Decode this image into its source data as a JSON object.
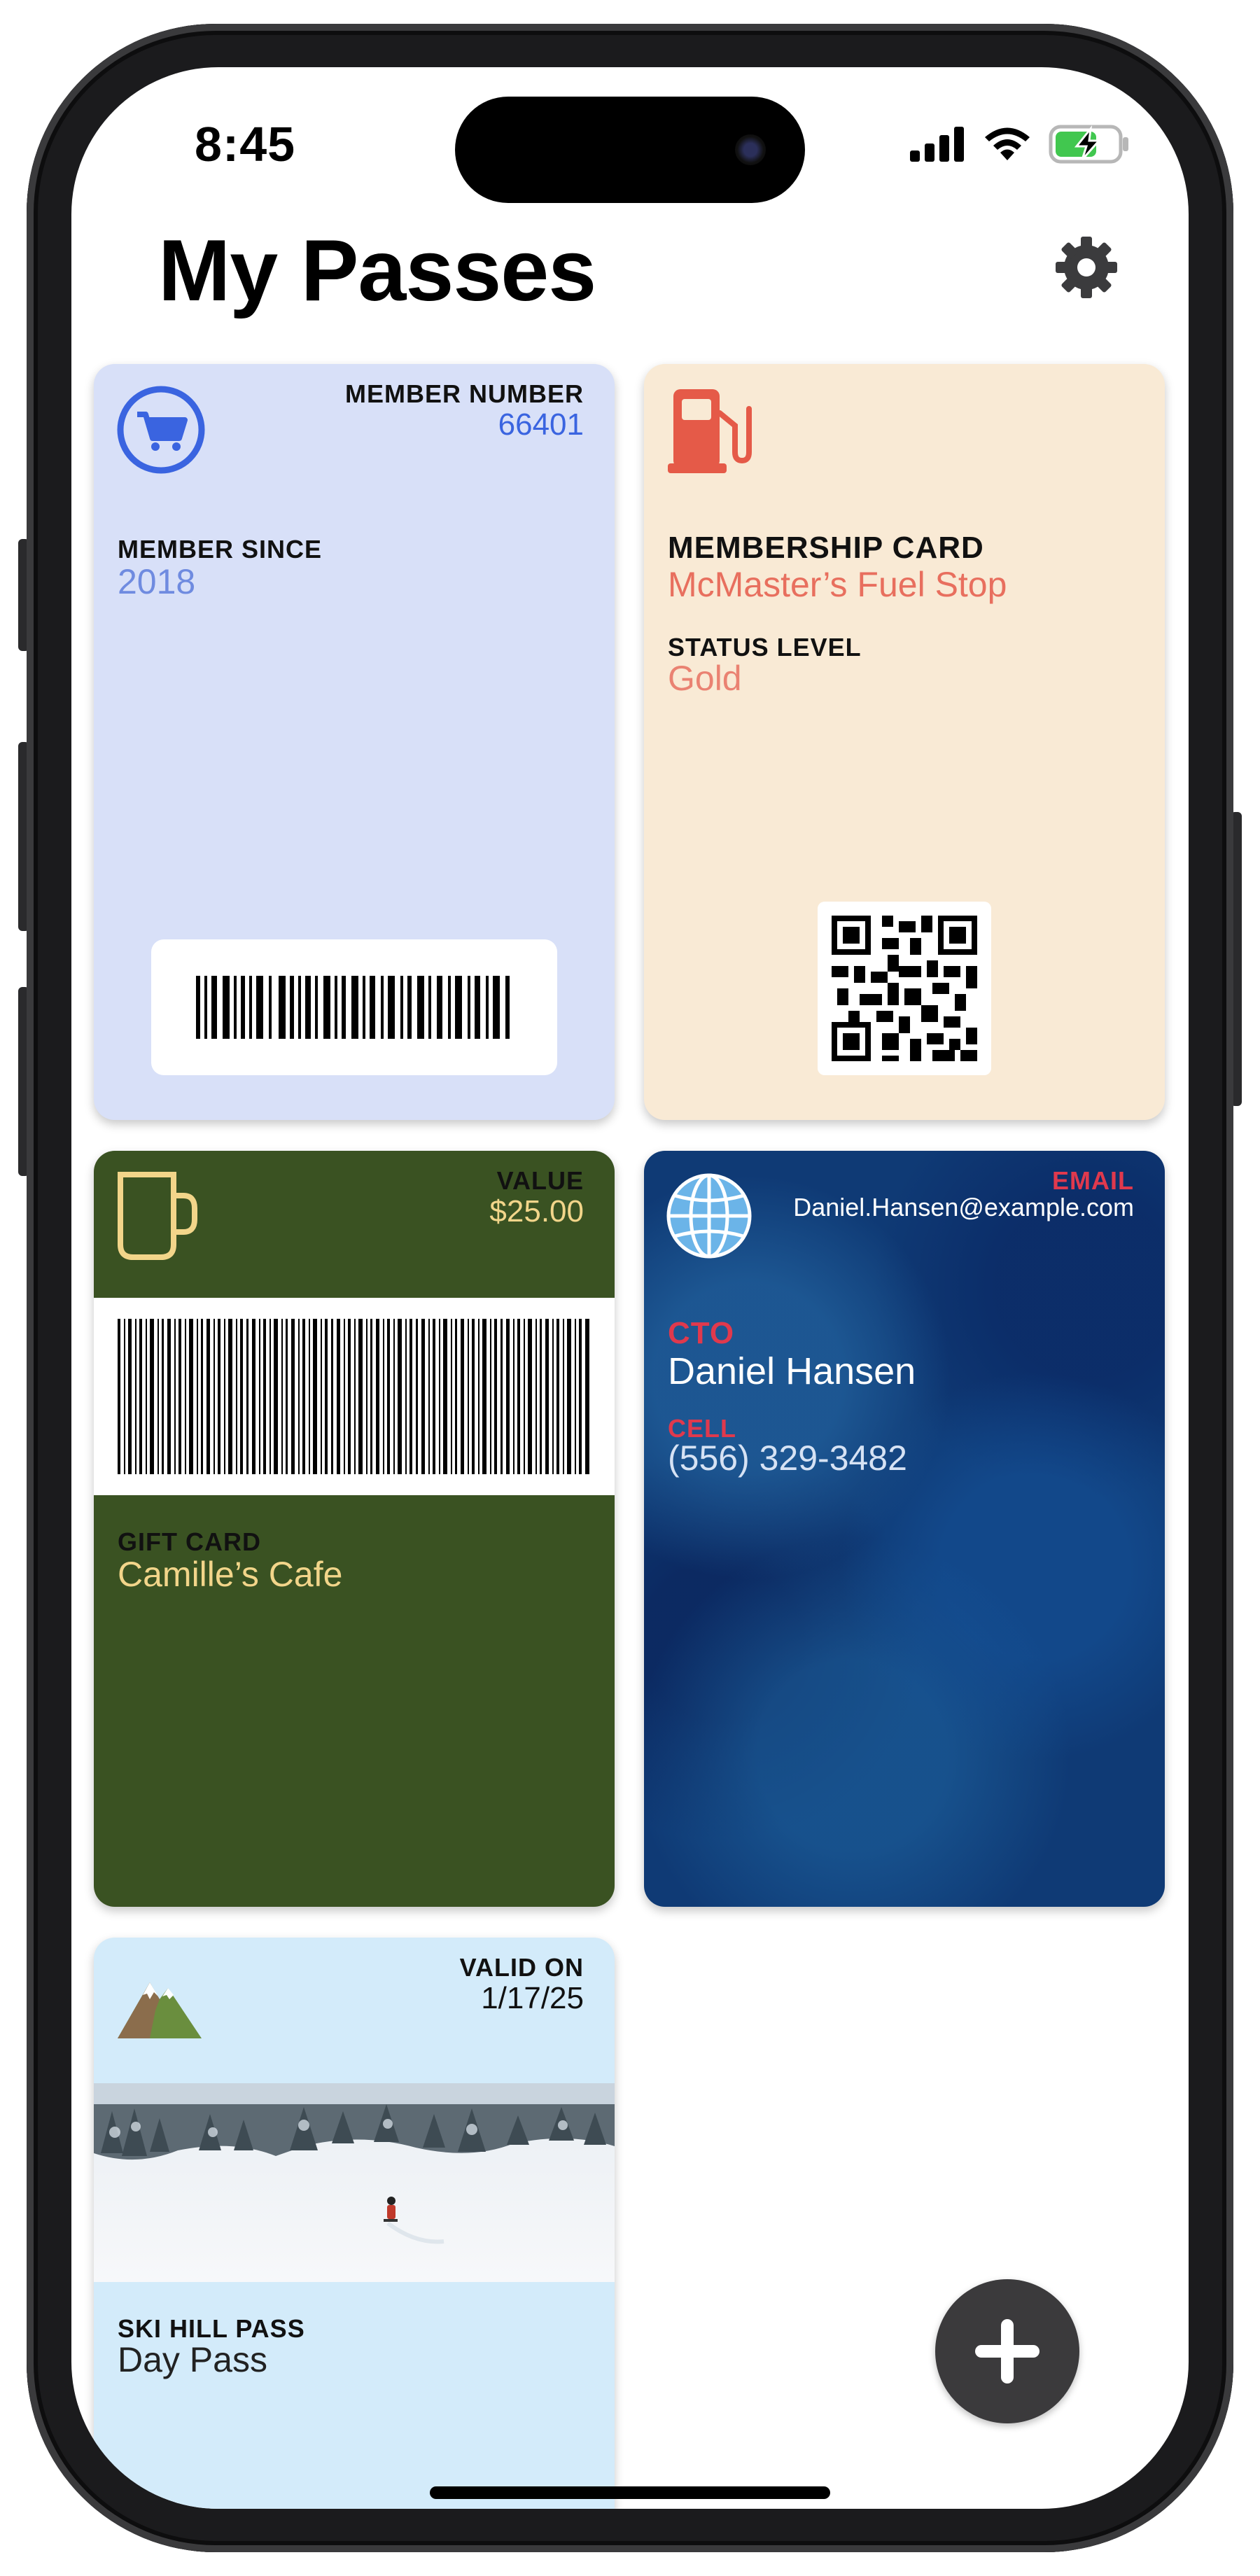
{
  "status_bar": {
    "time": "8:45"
  },
  "header": {
    "title": "My Passes",
    "settings_icon": "gear-icon"
  },
  "cards": {
    "grocery": {
      "icon": "shopping-cart-icon",
      "member_number_label": "MEMBER NUMBER",
      "member_number": "66401",
      "member_since_label": "MEMBER SINCE",
      "member_since": "2018",
      "background": "#d8e0f8",
      "accent": "#3a64e0"
    },
    "fuel": {
      "icon": "fuel-pump-icon",
      "type_label": "MEMBERSHIP CARD",
      "name": "McMaster’s Fuel Stop",
      "status_label": "STATUS LEVEL",
      "status": "Gold",
      "background": "#f9ead5",
      "accent": "#e55a48"
    },
    "cafe": {
      "icon": "mug-icon",
      "value_label": "VALUE",
      "value": "$25.00",
      "type_label": "GIFT CARD",
      "name": "Camille’s Cafe",
      "background": "#3a5222",
      "accent": "#f2d58a"
    },
    "contact": {
      "icon": "globe-icon",
      "email_label": "EMAIL",
      "email": "Daniel.Hansen@example.com",
      "title_label": "CTO",
      "name": "Daniel Hansen",
      "cell_label": "CELL",
      "cell": "(556) 329-3482",
      "background": "#0f3a75",
      "accent": "#e0394d"
    },
    "ski": {
      "icon": "mountain-icon",
      "valid_label": "VALID ON",
      "valid_date": "1/17/25",
      "type_label": "SKI HILL PASS",
      "name": "Day Pass",
      "background": "#d3ebfa"
    }
  },
  "fab": {
    "icon": "plus-icon"
  }
}
